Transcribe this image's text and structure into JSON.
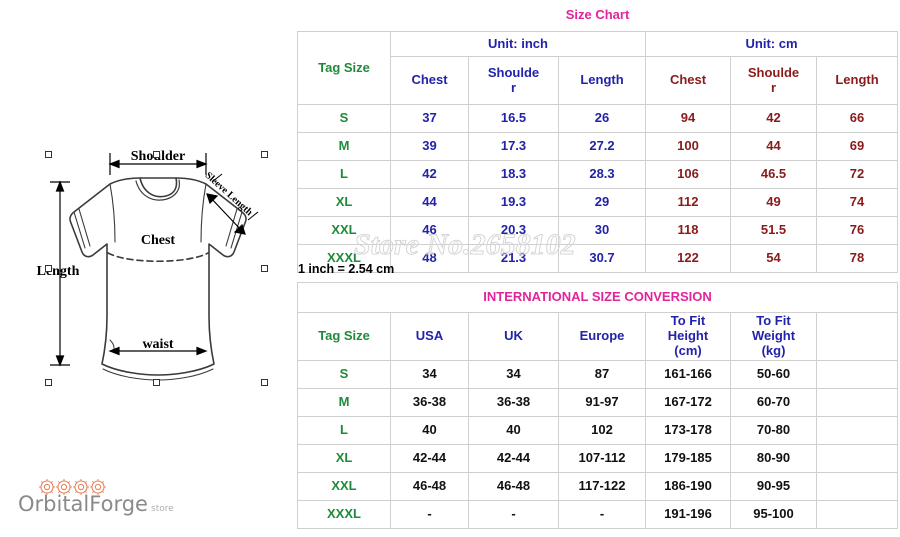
{
  "logo": {
    "name": "OrbitalForge",
    "sub": "store",
    "gear_color": "#e8855f"
  },
  "diagram": {
    "labels": {
      "shoulder": "Shoulder",
      "sleeve_length": "Sleeve Length",
      "chest": "Chest",
      "length": "Length",
      "waist": "waist"
    }
  },
  "watermark": "Store No.2658102",
  "inch_note": "1 inch = 2.54 cm",
  "colors": {
    "title": "#e3239b",
    "inch": "#2222aa",
    "cm": "#8b1a1a",
    "tag": "#1f8b3a",
    "black": "#111111"
  },
  "size_chart": {
    "title": "Size Chart",
    "tag_size_header": "Tag Size",
    "unit_groups": [
      {
        "label": "Unit: inch",
        "columns": [
          "Chest",
          "Shoulde\nr",
          "Length"
        ]
      },
      {
        "label": "Unit: cm",
        "columns": [
          "Chest",
          "Shoulde\nr",
          "Length"
        ]
      }
    ],
    "unit_inch_label": "Unit: inch",
    "unit_cm_label": "Unit: cm",
    "inch_cols": [
      "Chest",
      "Shoulder",
      "Length"
    ],
    "cm_cols": [
      "Chest",
      "Shoulder",
      "Length"
    ],
    "rows": [
      {
        "tag": "S",
        "inch": [
          "37",
          "16.5",
          "26"
        ],
        "cm": [
          "94",
          "42",
          "66"
        ]
      },
      {
        "tag": "M",
        "inch": [
          "39",
          "17.3",
          "27.2"
        ],
        "cm": [
          "100",
          "44",
          "69"
        ]
      },
      {
        "tag": "L",
        "inch": [
          "42",
          "18.3",
          "28.3"
        ],
        "cm": [
          "106",
          "46.5",
          "72"
        ]
      },
      {
        "tag": "XL",
        "inch": [
          "44",
          "19.3",
          "29"
        ],
        "cm": [
          "112",
          "49",
          "74"
        ]
      },
      {
        "tag": "XXL",
        "inch": [
          "46",
          "20.3",
          "30"
        ],
        "cm": [
          "118",
          "51.5",
          "76"
        ]
      },
      {
        "tag": "XXXL",
        "inch": [
          "48",
          "21.3",
          "30.7"
        ],
        "cm": [
          "122",
          "54",
          "78"
        ]
      }
    ]
  },
  "conversion_chart": {
    "title": "INTERNATIONAL SIZE CONVERSION",
    "columns": [
      "Tag Size",
      "USA",
      "UK",
      "Europe",
      "To Fit\nHeight\n(cm)",
      "To Fit\nWeight\n(kg)",
      ""
    ],
    "col_tag": "Tag Size",
    "col_usa": "USA",
    "col_uk": "UK",
    "col_europe": "Europe",
    "col_height": "To Fit Height (cm)",
    "col_weight": "To Fit Weight (kg)",
    "rows": [
      {
        "tag": "S",
        "usa": "34",
        "uk": "34",
        "europe": "87",
        "height": "161-166",
        "weight": "50-60"
      },
      {
        "tag": "M",
        "usa": "36-38",
        "uk": "36-38",
        "europe": "91-97",
        "height": "167-172",
        "weight": "60-70"
      },
      {
        "tag": "L",
        "usa": "40",
        "uk": "40",
        "europe": "102",
        "height": "173-178",
        "weight": "70-80"
      },
      {
        "tag": "XL",
        "usa": "42-44",
        "uk": "42-44",
        "europe": "107-112",
        "height": "179-185",
        "weight": "80-90"
      },
      {
        "tag": "XXL",
        "usa": "46-48",
        "uk": "46-48",
        "europe": "117-122",
        "height": "186-190",
        "weight": "90-95"
      },
      {
        "tag": "XXXL",
        "usa": "-",
        "uk": "-",
        "europe": "-",
        "height": "191-196",
        "weight": "95-100"
      }
    ]
  }
}
